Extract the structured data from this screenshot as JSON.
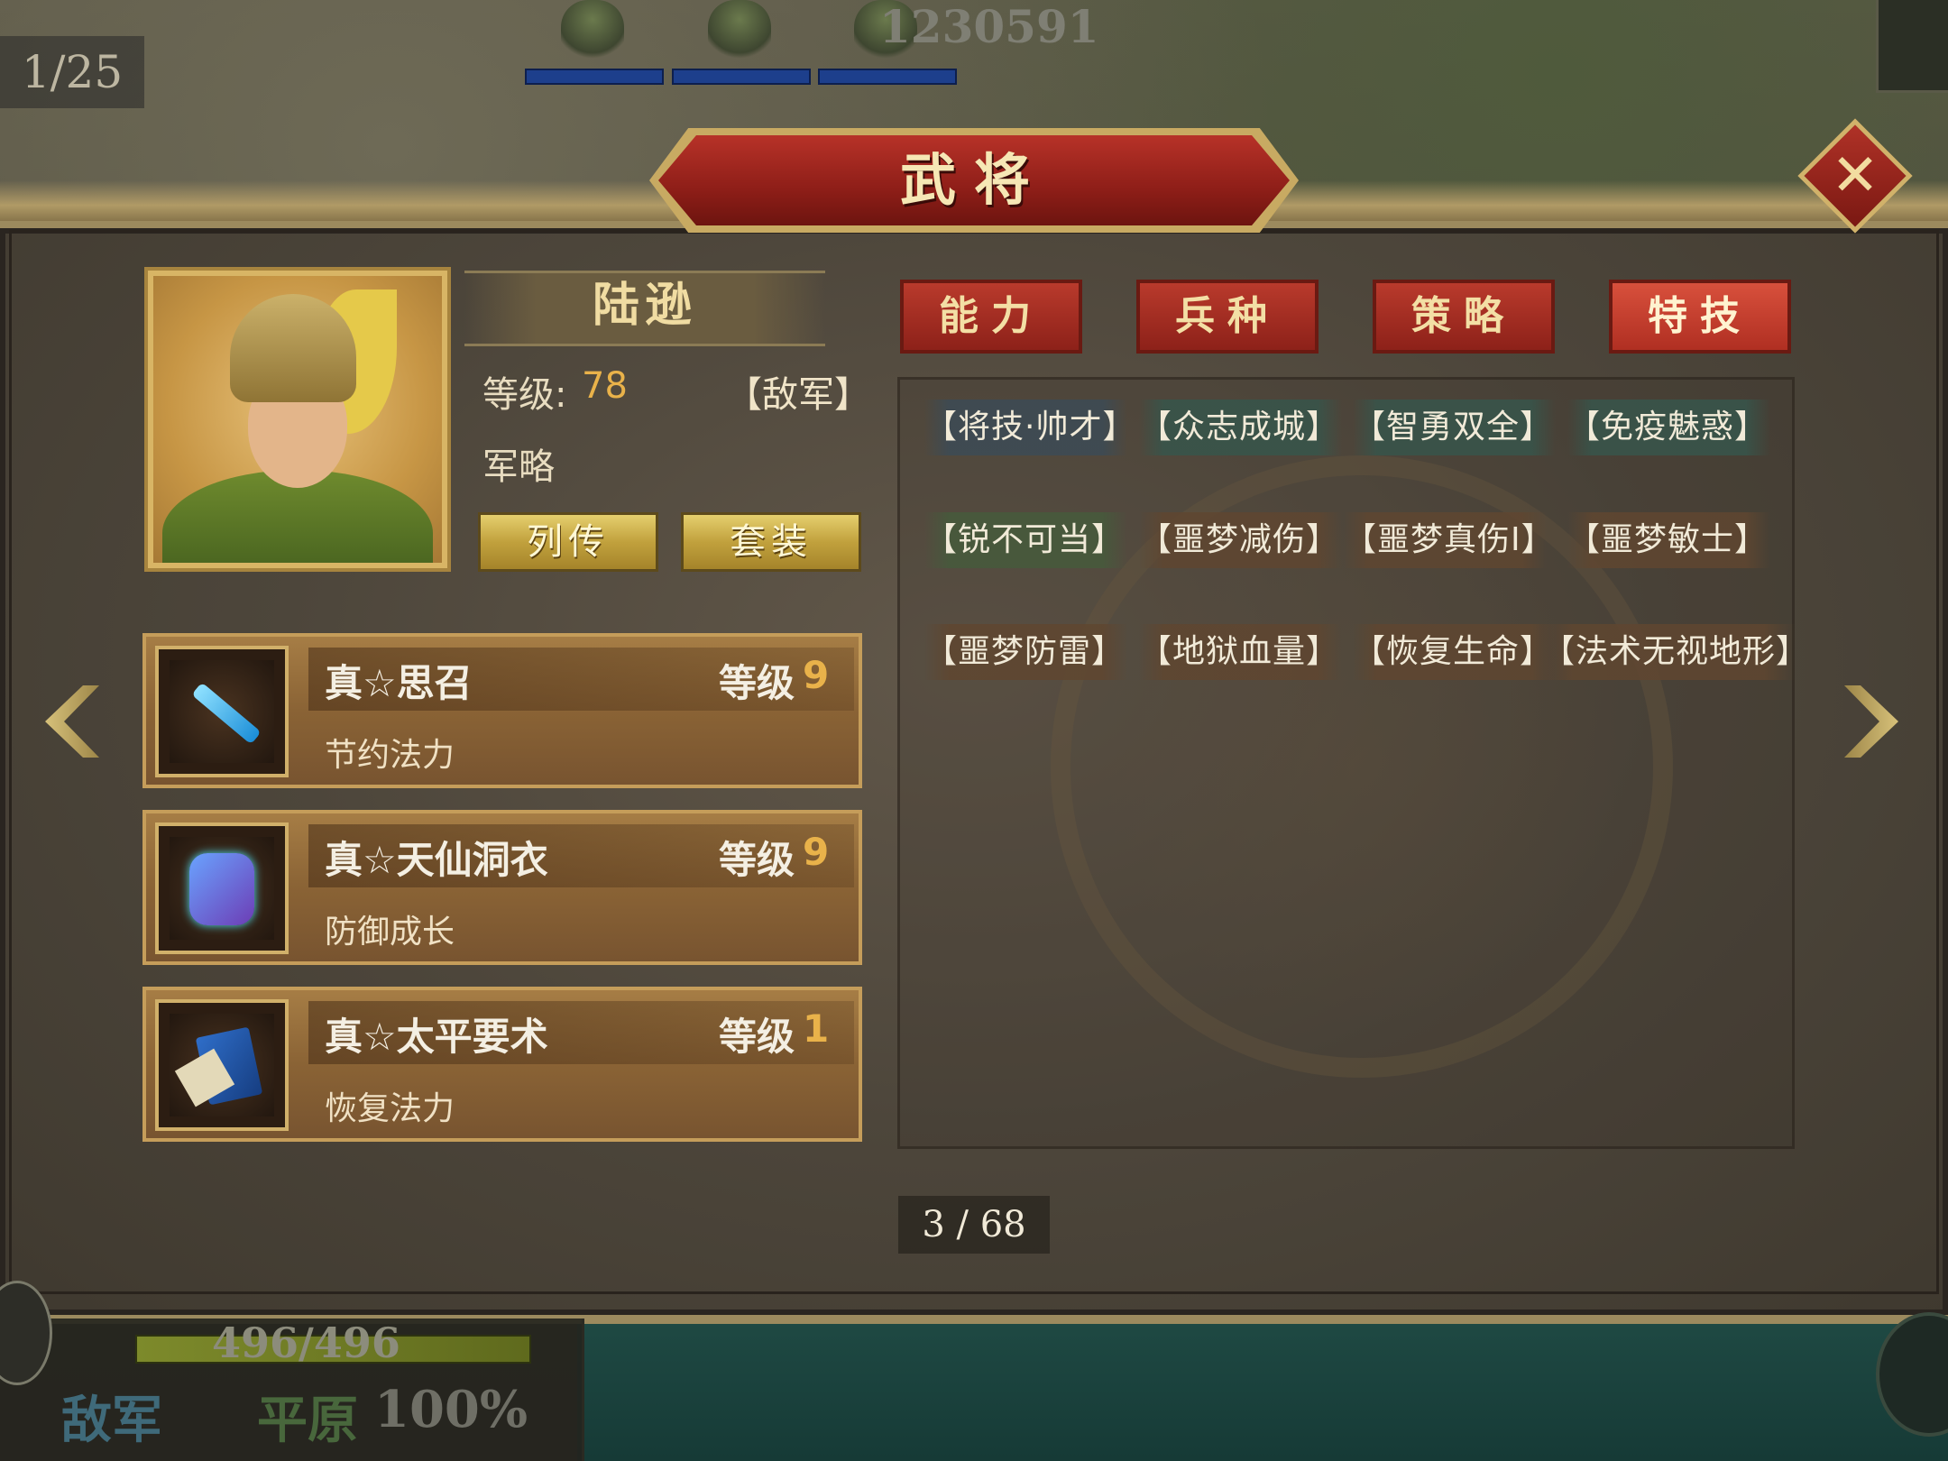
{
  "top": {
    "page_counter": "1/25",
    "score": "1230591"
  },
  "window": {
    "title": "武将",
    "close_icon": "close-icon"
  },
  "general": {
    "name": "陆逊",
    "level_label": "等级:",
    "level_value": "78",
    "faction": "【敌军】",
    "class": "军略",
    "bio_button": "列传",
    "set_button": "套装"
  },
  "equipment": [
    {
      "name": "真☆思召",
      "level_label": "等级",
      "level": "9",
      "effect": "节约法力",
      "icon": "sword-icon"
    },
    {
      "name": "真☆天仙洞衣",
      "level_label": "等级",
      "level": "9",
      "effect": "防御成长",
      "icon": "armor-icon"
    },
    {
      "name": "真☆太平要术",
      "level_label": "等级",
      "level": "1",
      "effect": "恢复法力",
      "icon": "book-icon"
    }
  ],
  "tabs": [
    {
      "label": "能力",
      "active": false
    },
    {
      "label": "兵种",
      "active": false
    },
    {
      "label": "策略",
      "active": false
    },
    {
      "label": "特技",
      "active": true
    }
  ],
  "skills": [
    "【将技·帅才】",
    "【众志成城】",
    "【智勇双全】",
    "【免疫魅惑】",
    "【锐不可当】",
    "【噩梦减伤】",
    "【噩梦真伤Ⅰ】",
    "【噩梦敏士】",
    "【噩梦防雷】",
    "【地狱血量】",
    "【恢复生命】",
    "【法术无视地形】"
  ],
  "pager": "3 / 68",
  "hud": {
    "hp": "496/496",
    "hp_fraction": 1.0,
    "faction": "敌军",
    "terrain": "平原",
    "terrain_pct": "100%"
  },
  "colors": {
    "tab_red": "#b93a2c",
    "gold": "#d8b565",
    "level_orange": "#e9b24a"
  }
}
